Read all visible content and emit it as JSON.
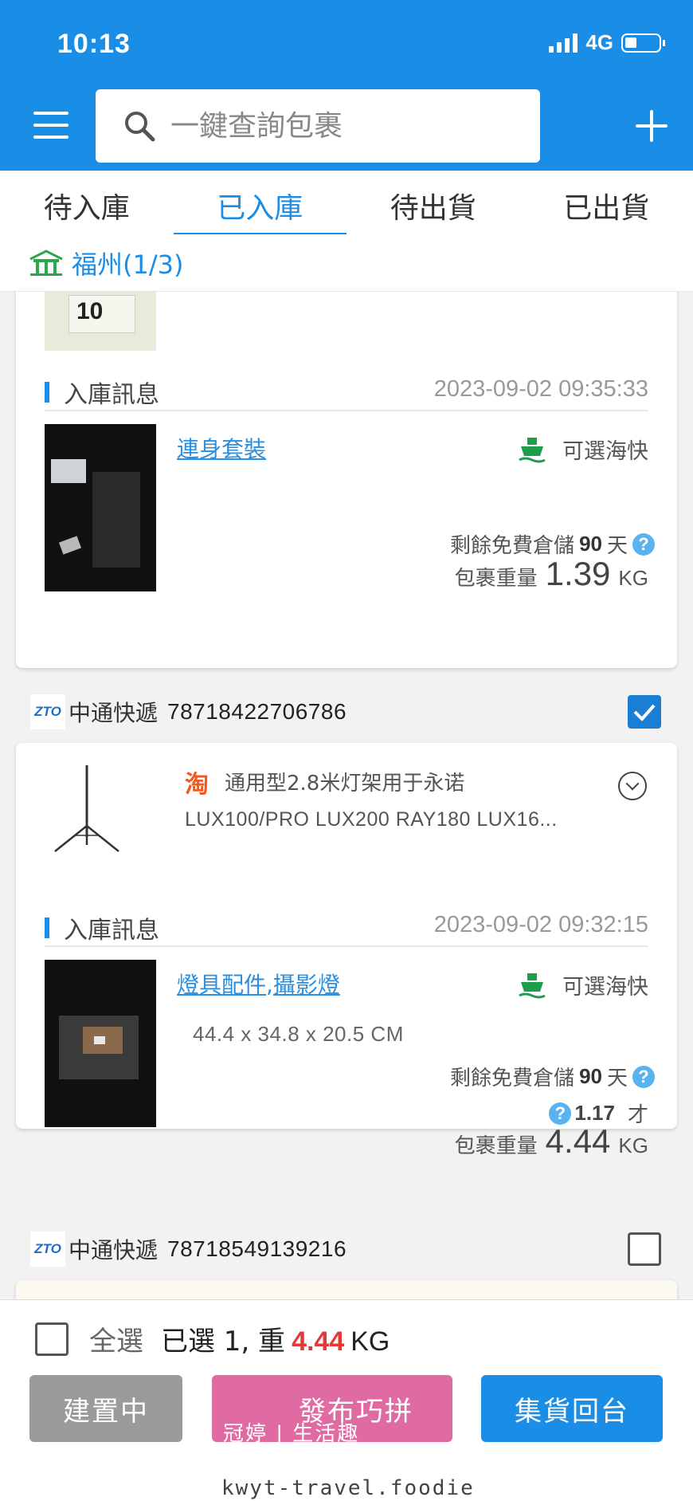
{
  "status_bar": {
    "time": "10:13",
    "network": "4G"
  },
  "header": {
    "search_placeholder": "一鍵查詢包裹"
  },
  "tabs": [
    {
      "label": "待入庫",
      "active": false
    },
    {
      "label": "已入庫",
      "active": true
    },
    {
      "label": "待出貨",
      "active": false
    },
    {
      "label": "已出貨",
      "active": false
    }
  ],
  "warehouse": {
    "label": "福州(1/3)"
  },
  "packages": [
    {
      "partial_top_price": "10",
      "section_title": "入庫訊息",
      "inbound_time": "2023-09-02 09:35:33",
      "categories": [
        "連身套裝"
      ],
      "shipping_option": "可選海快",
      "storage_prefix": "剩餘免費倉儲",
      "storage_days": "90",
      "storage_unit": "天",
      "weight_label": "包裹重量",
      "weight": "1.39",
      "weight_unit": "KG"
    },
    {
      "carrier": "中通快遞",
      "carrier_logo": "ZTO",
      "tracking_no": "78718422706786",
      "checked": true,
      "product_title": "通用型2.8米灯架用于永诺",
      "product_subtitle": "LUX100/PRO LUX200 RAY180 LUX16...",
      "section_title": "入庫訊息",
      "inbound_time": "2023-09-02 09:32:15",
      "categories": [
        "燈具配件",
        "攝影燈"
      ],
      "category_sep": ",",
      "shipping_option": "可選海快",
      "dimensions": "44.4 x 34.8 x 20.5 CM",
      "storage_prefix": "剩餘免費倉儲",
      "storage_days": "90",
      "storage_unit": "天",
      "cuft": "1.17",
      "cuft_unit": "才",
      "weight_label": "包裹重量",
      "weight": "4.44",
      "weight_unit": "KG"
    },
    {
      "carrier": "中通快遞",
      "carrier_logo": "ZTO",
      "tracking_no": "78718549139216",
      "checked": false
    }
  ],
  "bottom_bar": {
    "select_all": "全選",
    "selected_prefix": "已選 1, 重",
    "selected_weight": "4.44",
    "selected_unit": "KG",
    "btn_building": "建置中",
    "btn_publish": "發布巧拼",
    "btn_consolidate": "集貨回台"
  },
  "watermark": {
    "overlay": "冠婷 | 生活趣",
    "url": "kwyt-travel.foodie"
  },
  "colors": {
    "primary": "#1a8ee6",
    "accent_red": "#e53935",
    "pink": "#e06ba3",
    "grey": "#9b9b9b",
    "ship_green": "#1e9e4a"
  }
}
